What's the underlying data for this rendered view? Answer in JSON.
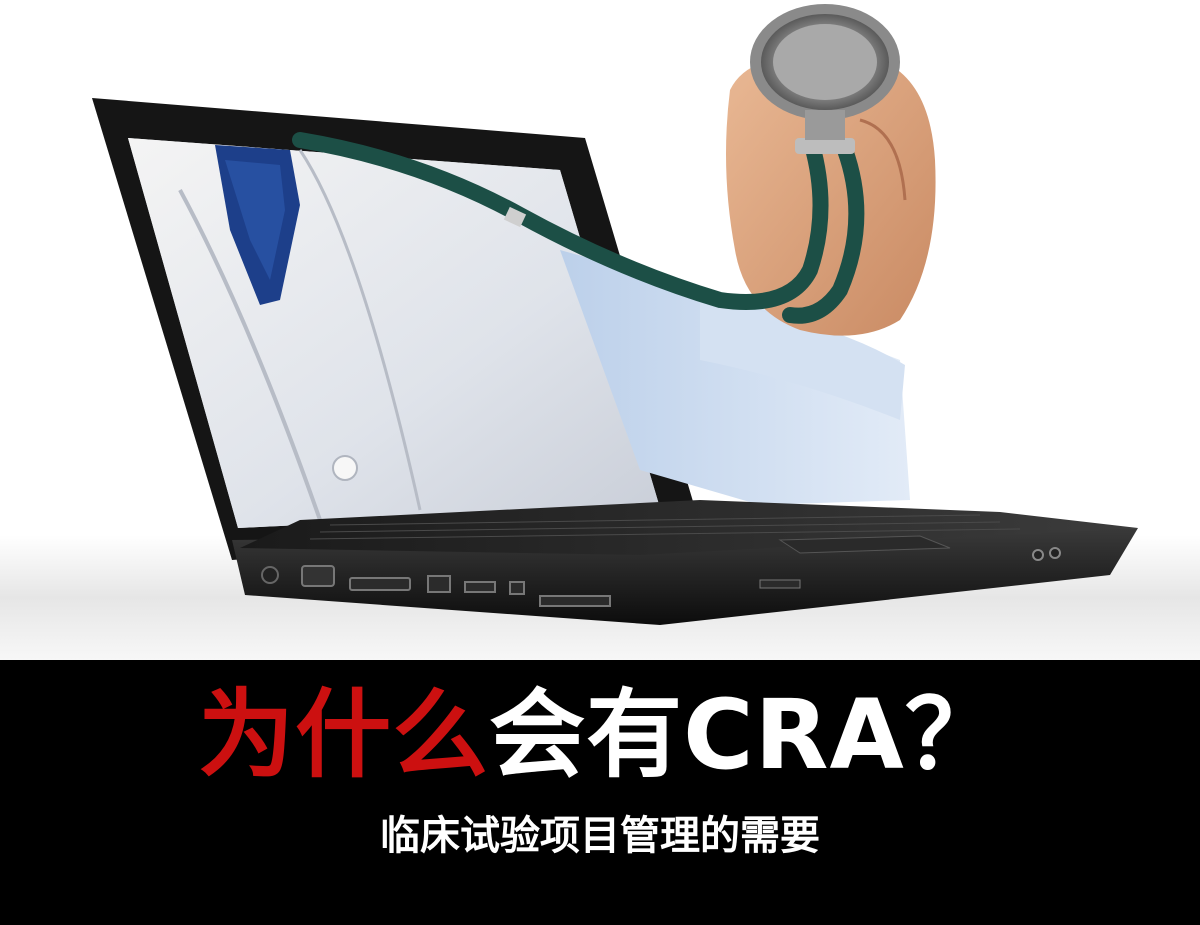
{
  "headline": {
    "red_part": "为什么",
    "white_part": "会有CRA？"
  },
  "subtitle": "临床试验项目管理的需要",
  "colors": {
    "accent_red": "#cc1010",
    "band": "#000000",
    "text_light": "#ffffff"
  },
  "illustration": {
    "description_icon": "laptop-doctor-stethoscope-icon"
  }
}
